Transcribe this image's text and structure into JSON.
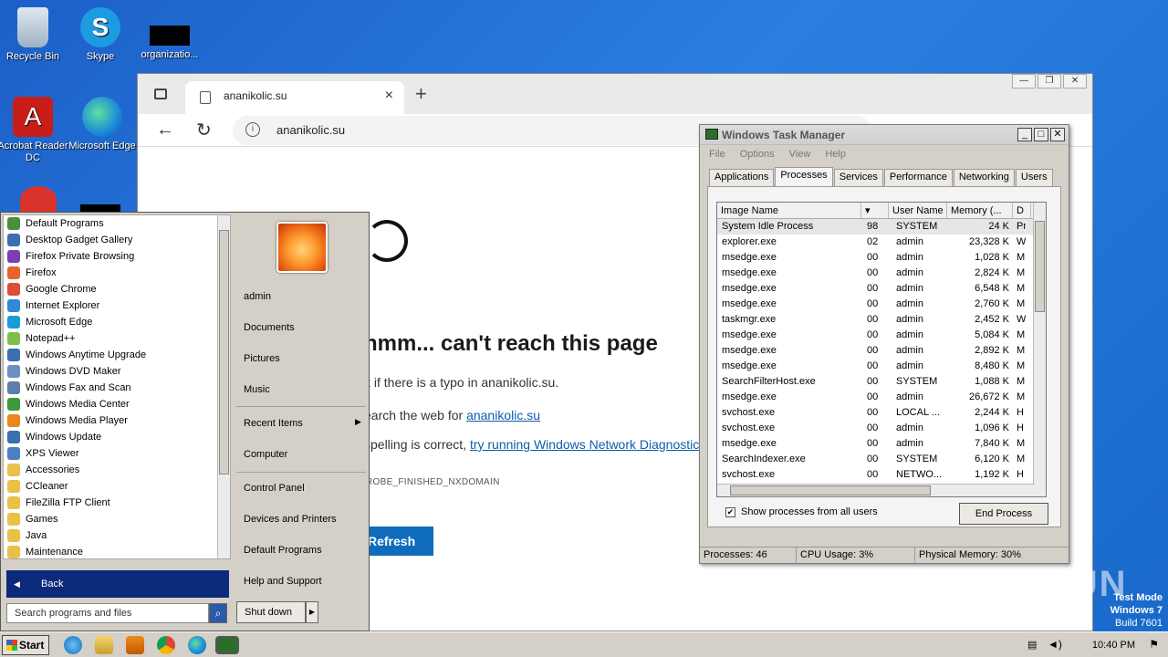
{
  "desktop": {
    "icons": [
      {
        "label": "Recycle Bin"
      },
      {
        "label": "Skype"
      },
      {
        "label": "organizatio..."
      },
      {
        "label": "Acrobat Reader DC"
      },
      {
        "label": "Microsoft Edge"
      }
    ]
  },
  "browser": {
    "tab_title": "ananikolic.su",
    "url": "ananikolic.su",
    "error": {
      "title": "hmm... can't reach this page",
      "line1": "k if there is a typo in ananikolic.su.",
      "line2_prefix": "earch the web for ",
      "line2_link": "ananikolic.su",
      "line3_prefix": "spelling is correct, ",
      "line3_link": "try running Windows Network Diagnostic",
      "code": "ROBE_FINISHED_NXDOMAIN",
      "refresh": "Refresh"
    }
  },
  "taskmgr": {
    "title": "Windows Task Manager",
    "menu": [
      "File",
      "Options",
      "View",
      "Help"
    ],
    "tabs": [
      "Applications",
      "Processes",
      "Services",
      "Performance",
      "Networking",
      "Users"
    ],
    "columns": {
      "name": "Image Name",
      "user": "User Name",
      "mem": "Memory (...",
      "d": "D"
    },
    "rows": [
      {
        "name": "System Idle Process",
        "cpu": "98",
        "user": "SYSTEM",
        "mem": "24 K",
        "d": "Pr"
      },
      {
        "name": "explorer.exe",
        "cpu": "02",
        "user": "admin",
        "mem": "23,328 K",
        "d": "W"
      },
      {
        "name": "msedge.exe",
        "cpu": "00",
        "user": "admin",
        "mem": "1,028 K",
        "d": "M"
      },
      {
        "name": "msedge.exe",
        "cpu": "00",
        "user": "admin",
        "mem": "2,824 K",
        "d": "M"
      },
      {
        "name": "msedge.exe",
        "cpu": "00",
        "user": "admin",
        "mem": "6,548 K",
        "d": "M"
      },
      {
        "name": "msedge.exe",
        "cpu": "00",
        "user": "admin",
        "mem": "2,760 K",
        "d": "M"
      },
      {
        "name": "taskmgr.exe",
        "cpu": "00",
        "user": "admin",
        "mem": "2,452 K",
        "d": "W"
      },
      {
        "name": "msedge.exe",
        "cpu": "00",
        "user": "admin",
        "mem": "5,084 K",
        "d": "M"
      },
      {
        "name": "msedge.exe",
        "cpu": "00",
        "user": "admin",
        "mem": "2,892 K",
        "d": "M"
      },
      {
        "name": "msedge.exe",
        "cpu": "00",
        "user": "admin",
        "mem": "8,480 K",
        "d": "M"
      },
      {
        "name": "SearchFilterHost.exe",
        "cpu": "00",
        "user": "SYSTEM",
        "mem": "1,088 K",
        "d": "M"
      },
      {
        "name": "msedge.exe",
        "cpu": "00",
        "user": "admin",
        "mem": "26,672 K",
        "d": "M"
      },
      {
        "name": "svchost.exe",
        "cpu": "00",
        "user": "LOCAL ...",
        "mem": "2,244 K",
        "d": "H"
      },
      {
        "name": "svchost.exe",
        "cpu": "00",
        "user": "admin",
        "mem": "1,096 K",
        "d": "H"
      },
      {
        "name": "msedge.exe",
        "cpu": "00",
        "user": "admin",
        "mem": "7,840 K",
        "d": "M"
      },
      {
        "name": "SearchIndexer.exe",
        "cpu": "00",
        "user": "SYSTEM",
        "mem": "6,120 K",
        "d": "M"
      },
      {
        "name": "svchost.exe",
        "cpu": "00",
        "user": "NETWO...",
        "mem": "1,192 K",
        "d": "H"
      }
    ],
    "show_all": "Show processes from all users",
    "end_process": "End Process",
    "status": {
      "processes": "Processes: 46",
      "cpu": "CPU Usage: 3%",
      "mem": "Physical Memory: 30%"
    }
  },
  "startmenu": {
    "programs": [
      {
        "label": "Default Programs",
        "color": "#4a8f3c"
      },
      {
        "label": "Desktop Gadget Gallery",
        "color": "#3a6fb0"
      },
      {
        "label": "Firefox Private Browsing",
        "color": "#7b3fb5"
      },
      {
        "label": "Firefox",
        "color": "#e8642c"
      },
      {
        "label": "Google Chrome",
        "color": "#dd4b39"
      },
      {
        "label": "Internet Explorer",
        "color": "#2f8ad8"
      },
      {
        "label": "Microsoft Edge",
        "color": "#1a9bd7"
      },
      {
        "label": "Notepad++",
        "color": "#7cbf4a"
      },
      {
        "label": "Windows Anytime Upgrade",
        "color": "#3a6fb0"
      },
      {
        "label": "Windows DVD Maker",
        "color": "#6a8fc0"
      },
      {
        "label": "Windows Fax and Scan",
        "color": "#5a7fa8"
      },
      {
        "label": "Windows Media Center",
        "color": "#3c9a3c"
      },
      {
        "label": "Windows Media Player",
        "color": "#e88a1a"
      },
      {
        "label": "Windows Update",
        "color": "#3a6fb0"
      },
      {
        "label": "XPS Viewer",
        "color": "#4a7fc0"
      },
      {
        "label": "Accessories",
        "color": "#e8c04a"
      },
      {
        "label": "CCleaner",
        "color": "#e8c04a"
      },
      {
        "label": "FileZilla FTP Client",
        "color": "#e8c04a"
      },
      {
        "label": "Games",
        "color": "#e8c04a"
      },
      {
        "label": "Java",
        "color": "#e8c04a"
      },
      {
        "label": "Maintenance",
        "color": "#e8c04a"
      }
    ],
    "back": "Back",
    "search_placeholder": "Search programs and files",
    "right_links": {
      "user": "admin",
      "documents": "Documents",
      "pictures": "Pictures",
      "music": "Music",
      "recent": "Recent Items",
      "computer": "Computer",
      "control_panel": "Control Panel",
      "devices": "Devices and Printers",
      "default_programs": "Default Programs",
      "help": "Help and Support"
    },
    "shutdown": "Shut down"
  },
  "taskbar": {
    "start": "Start",
    "time": "10:40 PM"
  },
  "watermark": {
    "line1": "Test Mode",
    "line2": "Windows 7",
    "line3": "Build 7601",
    "brand": "ANY RUN"
  }
}
